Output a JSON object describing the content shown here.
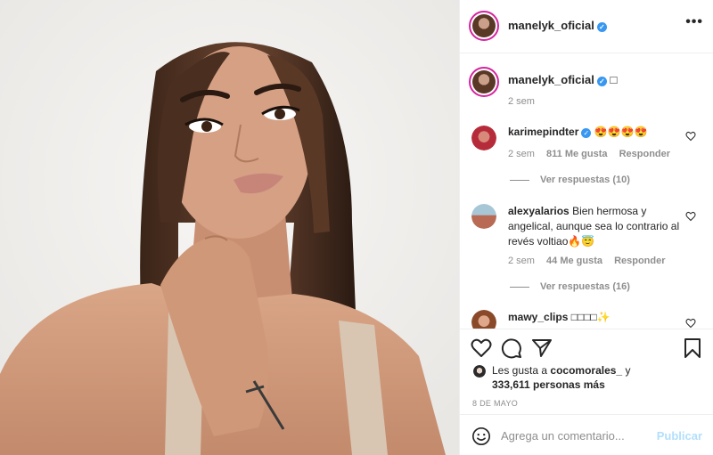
{
  "post": {
    "username": "manelyk_oficial",
    "caption": "□",
    "caption_time": "2 sem",
    "photo_description_icon": "portrait-photo"
  },
  "comments": [
    {
      "username": "karimepindter",
      "verified": true,
      "text": "😍😍😍😍",
      "time": "2 sem",
      "likes": "811 Me gusta",
      "reply": "Responder",
      "view_replies": "Ver respuestas (10)"
    },
    {
      "username": "alexyalarios",
      "verified": false,
      "text": "Bien hermosa y angelical, aunque sea lo contrario al revés voltiao🔥😇",
      "time": "2 sem",
      "likes": "44 Me gusta",
      "reply": "Responder",
      "view_replies": "Ver respuestas (16)"
    },
    {
      "username": "mawy_clips",
      "verified": false,
      "text": "□□□□✨"
    }
  ],
  "actions": {
    "like_icon": "heart-outline",
    "comment_icon": "speech-bubble",
    "share_icon": "paper-plane",
    "save_icon": "bookmark",
    "likes_prefix": "Les gusta a",
    "likes_user": "cocomorales_",
    "likes_conj": "y",
    "likes_count": "333,611 personas más",
    "date": "8 DE MAYO"
  },
  "add_comment": {
    "placeholder": "Agrega un comentario...",
    "publish": "Publicar"
  },
  "colors": {
    "verified": "#3897f0",
    "muted": "#8e8e8e",
    "publish_disabled": "#b2dffc",
    "story_ring": "#d6249f"
  }
}
